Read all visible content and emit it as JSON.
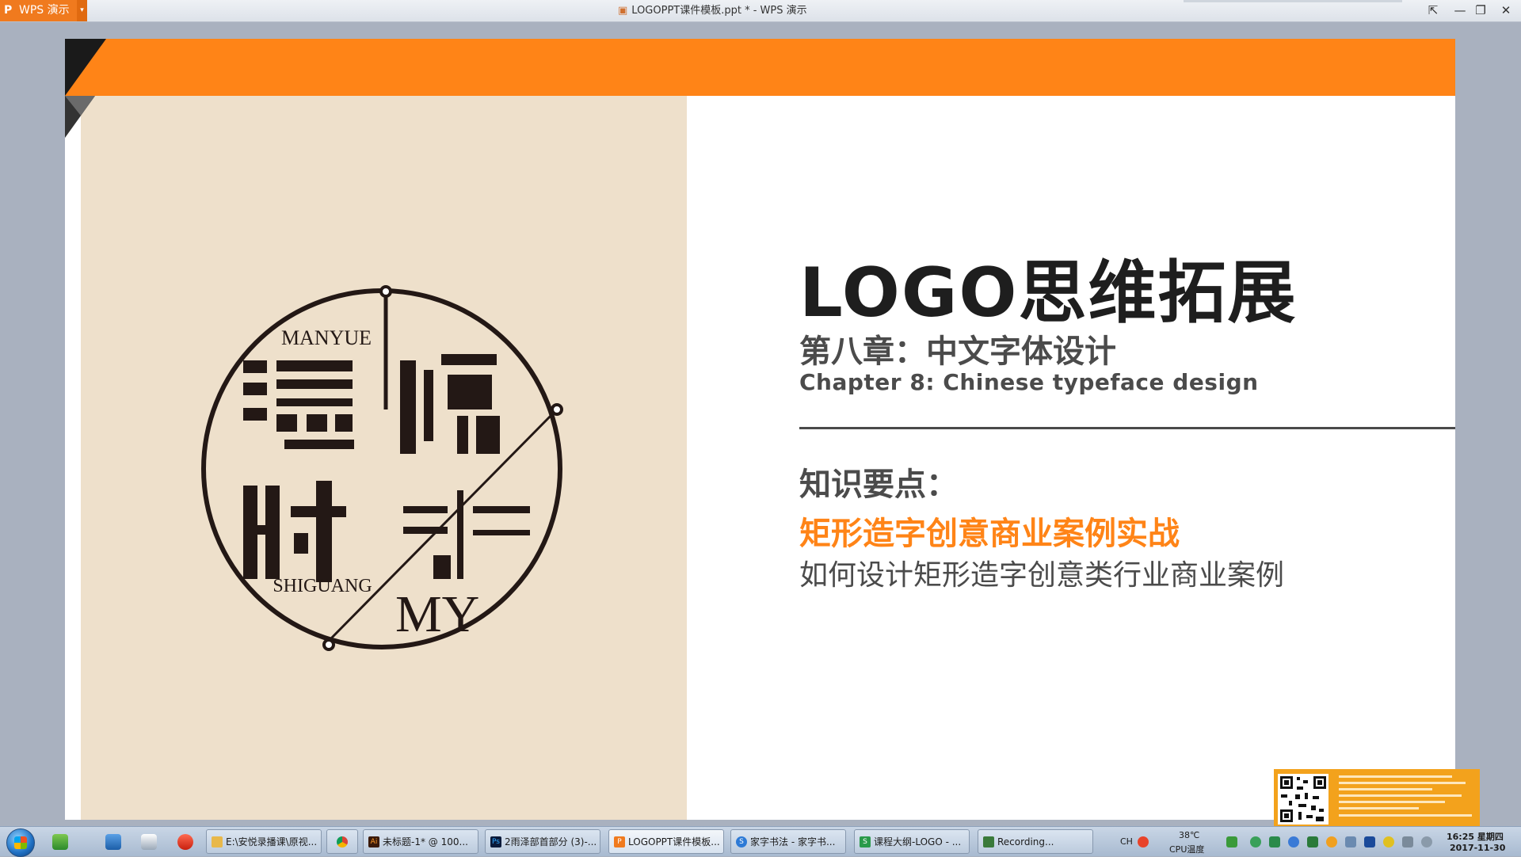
{
  "app": {
    "logo": "P",
    "name": "WPS 演示",
    "dropdown_glyph": "▾",
    "window_title": "LOGOPPT课件模板.ppt * - WPS 演示"
  },
  "window_controls": [
    "⇱",
    "—",
    "❐",
    "✕"
  ],
  "slide": {
    "logo_text": {
      "top_en": "MANYUE",
      "bottom_en": "SHIGUANG",
      "monogram": "MY"
    },
    "title": "LOGO思维拓展",
    "chapter_cn": "第八章：中文字体设计",
    "chapter_en": "Chapter 8: Chinese typeface design",
    "kp_heading": "知识要点：",
    "kp_highlight": "矩形造字创意商业案例实战",
    "kp_desc": "如何设计矩形造字创意类行业商业案例"
  },
  "colors": {
    "accent": "#ff8417",
    "panel": "#eee0cb",
    "ink": "#231815"
  },
  "taskbar": {
    "tasks": [
      {
        "icon": "folder-icon",
        "label": "E:\\安悦录播课\\原视..."
      },
      {
        "icon": "chrome-icon",
        "label": ""
      },
      {
        "icon": "illustrator-icon",
        "label": "未标题-1* @ 100..."
      },
      {
        "icon": "photoshop-icon",
        "label": "2雨泽部首部分 (3)-..."
      },
      {
        "icon": "wps-presentation-icon",
        "label": "LOGOPPT课件模板..."
      },
      {
        "icon": "sogou-browser-icon",
        "label": "家字书法 - 家字书..."
      },
      {
        "icon": "wps-spreadsheet-icon",
        "label": "课程大纲-LOGO - ..."
      },
      {
        "icon": "recording-icon",
        "label": "Recording..."
      }
    ],
    "ime": "CH",
    "cpu_temp": "38℃",
    "cpu_label": "CPU温度",
    "time": "16:25 星期四",
    "date": "2017-11-30"
  }
}
